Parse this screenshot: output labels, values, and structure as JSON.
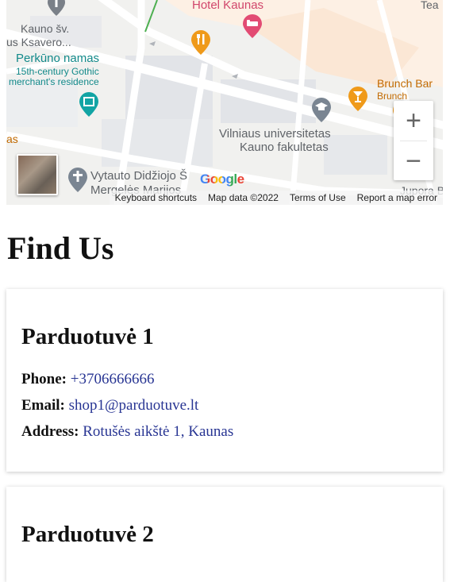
{
  "map": {
    "labels": {
      "hotel": "Hotel Kaunas",
      "tea": "Tea",
      "kauno_sv_1": "Kauno šv.",
      "kauno_sv_2": "us Ksavero...",
      "perkuno": "Perkūno namas",
      "perkuno_sub1": "15th-century Gothic",
      "perkuno_sub2": "merchant's residence",
      "brunch_bar": "Brunch Bar",
      "brunch": "Brunch",
      "univ_1": "Vilniaus universitetas",
      "univ_2": "Kauno fakultetas",
      "as": "as",
      "vytauto": "Vytauto Didžiojo Š",
      "mergeles": "Mergelės Marijos",
      "jupora": "Jupora B"
    },
    "zoom_in": "+",
    "zoom_out": "−",
    "google": "Google",
    "attribution": {
      "shortcuts": "Keyboard shortcuts",
      "map_data": "Map data ©2022",
      "terms": "Terms of Use",
      "report": "Report a map error"
    }
  },
  "page": {
    "title": "Find Us"
  },
  "shops": [
    {
      "name": "Parduotuvė 1",
      "phone_label": "Phone:",
      "phone": "+3706666666",
      "email_label": "Email:",
      "email": "shop1@parduotuve.lt",
      "address_label": "Address:",
      "address": "Rotušės aikštė 1, Kaunas"
    },
    {
      "name": "Parduotuvė 2"
    }
  ],
  "colors": {
    "value_text": "#283593",
    "teal_poi": "#138a8a",
    "orange_poi": "#e8900c",
    "hotel_pink": "#e24b73"
  }
}
